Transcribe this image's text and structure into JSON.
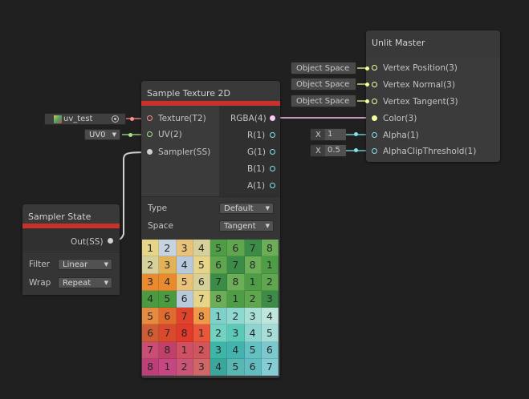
{
  "sample_texture": {
    "title": "Sample Texture 2D",
    "inputs": [
      "Texture(T2)",
      "UV(2)",
      "Sampler(SS)"
    ],
    "outputs": [
      "RGBA(4)",
      "R(1)",
      "G(1)",
      "B(1)",
      "A(1)"
    ],
    "type_label": "Type",
    "type_value": "Default",
    "space_label": "Space",
    "space_value": "Tangent"
  },
  "texture_field": {
    "value": "uv_test"
  },
  "uv_field": {
    "value": "UV0"
  },
  "sampler_state": {
    "title": "Sampler State",
    "output": "Out(SS)",
    "filter_label": "Filter",
    "filter_value": "Linear",
    "wrap_label": "Wrap",
    "wrap_value": "Repeat"
  },
  "unlit_master": {
    "title": "Unlit Master",
    "inputs": [
      "Vertex Position(3)",
      "Vertex Normal(3)",
      "Vertex Tangent(3)",
      "Color(3)",
      "Alpha(1)",
      "AlphaClipThreshold(1)"
    ]
  },
  "space_fields": [
    "Object Space",
    "Object Space",
    "Object Space"
  ],
  "alpha_field": {
    "axis": "X",
    "value": "1"
  },
  "clip_field": {
    "axis": "X",
    "value": "0.5"
  },
  "preview_grid": [
    [
      "1",
      "2",
      "3",
      "4",
      "5",
      "6",
      "7",
      "8"
    ],
    [
      "2",
      "3",
      "4",
      "5",
      "6",
      "7",
      "8",
      "1"
    ],
    [
      "3",
      "4",
      "5",
      "6",
      "7",
      "8",
      "1",
      "2"
    ],
    [
      "4",
      "5",
      "6",
      "7",
      "8",
      "1",
      "2",
      "3"
    ],
    [
      "5",
      "6",
      "7",
      "8",
      "1",
      "2",
      "3",
      "4"
    ],
    [
      "6",
      "7",
      "8",
      "1",
      "2",
      "3",
      "4",
      "5"
    ],
    [
      "7",
      "8",
      "1",
      "2",
      "3",
      "4",
      "5",
      "6"
    ],
    [
      "8",
      "1",
      "2",
      "3",
      "4",
      "5",
      "6",
      "7"
    ]
  ],
  "colors": {
    "accent_red": "#c8322b",
    "port_texture": "#ff8b8b",
    "port_vector2": "#a8e28a",
    "port_sampler": "#bcbcbc",
    "port_float": "#84e4e7",
    "port_vector3": "#f6ff9a",
    "port_vector4": "#fbcbf4"
  }
}
